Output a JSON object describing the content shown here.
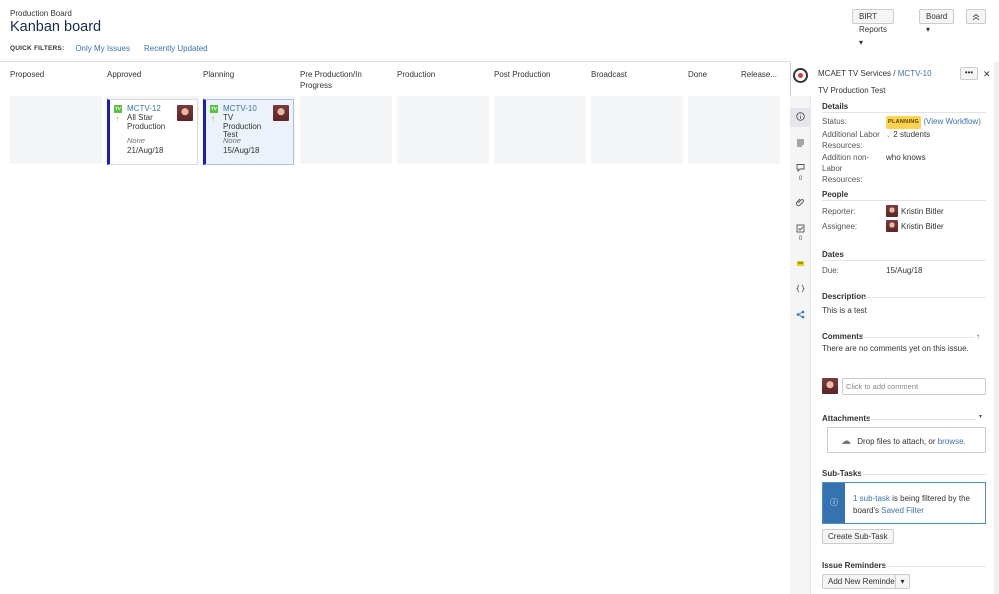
{
  "header": {
    "breadcrumb": "Production Board",
    "title": "Kanban board",
    "quick_filters_label": "QUICK FILTERS:",
    "quick_filters": [
      "Only My Issues",
      "Recently Updated"
    ],
    "birt_button": "BIRT Reports ▾",
    "board_button": "Board ▾",
    "collapse_icon": "double-chevron-up-icon"
  },
  "columns": [
    "Proposed",
    "Approved",
    "Planning",
    "Pre Production/In Progress",
    "Production",
    "Post Production",
    "Broadcast",
    "Done"
  ],
  "release_link": "Release...",
  "cards": [
    {
      "project_badge": "TV",
      "key": "MCTV-12",
      "summary": "All Star Production",
      "version": "None",
      "date": "21/Aug/18",
      "priority_icon": "arrow-up-icon"
    },
    {
      "project_badge": "TV",
      "key": "MCTV-10",
      "summary": "TV Production Test",
      "version": "None",
      "date": "15/Aug/18",
      "priority_icon": "arrow-up-icon"
    }
  ],
  "detail": {
    "project": "MCAET TV Services",
    "slash": "/",
    "issue_key": "MCTV-10",
    "issue_title": "TV Production Test",
    "more_label": "•••",
    "close_label": "✕",
    "strip_counts": {
      "comments": "0",
      "checklist": "0"
    },
    "details": {
      "heading": "Details",
      "status_label": "Status:",
      "status_value": "PLANNING",
      "workflow_link": "(View Workflow)",
      "labor_label": "Additional Labor Resources:",
      "labor_value": "2 students",
      "nonlabor_label": "Addition non-Labor Resources:",
      "nonlabor_value": "who knows"
    },
    "people": {
      "heading": "People",
      "reporter_label": "Reporter:",
      "reporter": "Kristin Bitler",
      "assignee_label": "Assignee:",
      "assignee": "Kristin Bitler"
    },
    "dates": {
      "heading": "Dates",
      "due_label": "Due:",
      "due": "15/Aug/18"
    },
    "description": {
      "heading": "Description",
      "text": "This is a test"
    },
    "comments": {
      "heading": "Comments",
      "empty_text": "There are no comments yet on this issue.",
      "placeholder": "Click to add comment"
    },
    "attachments": {
      "heading": "Attachments",
      "drop_text": "Drop files to attach, or",
      "browse": "browse."
    },
    "subtasks": {
      "heading": "Sub-Tasks",
      "count_link": "1 sub-task",
      "filtered_text": "is being filtered by the board's",
      "saved_filter": "Saved Filter",
      "create_button": "Create Sub-Task"
    },
    "reminders": {
      "heading": "Issue Reminders",
      "add_button": "Add New Reminder",
      "dropdown": "▾"
    }
  }
}
